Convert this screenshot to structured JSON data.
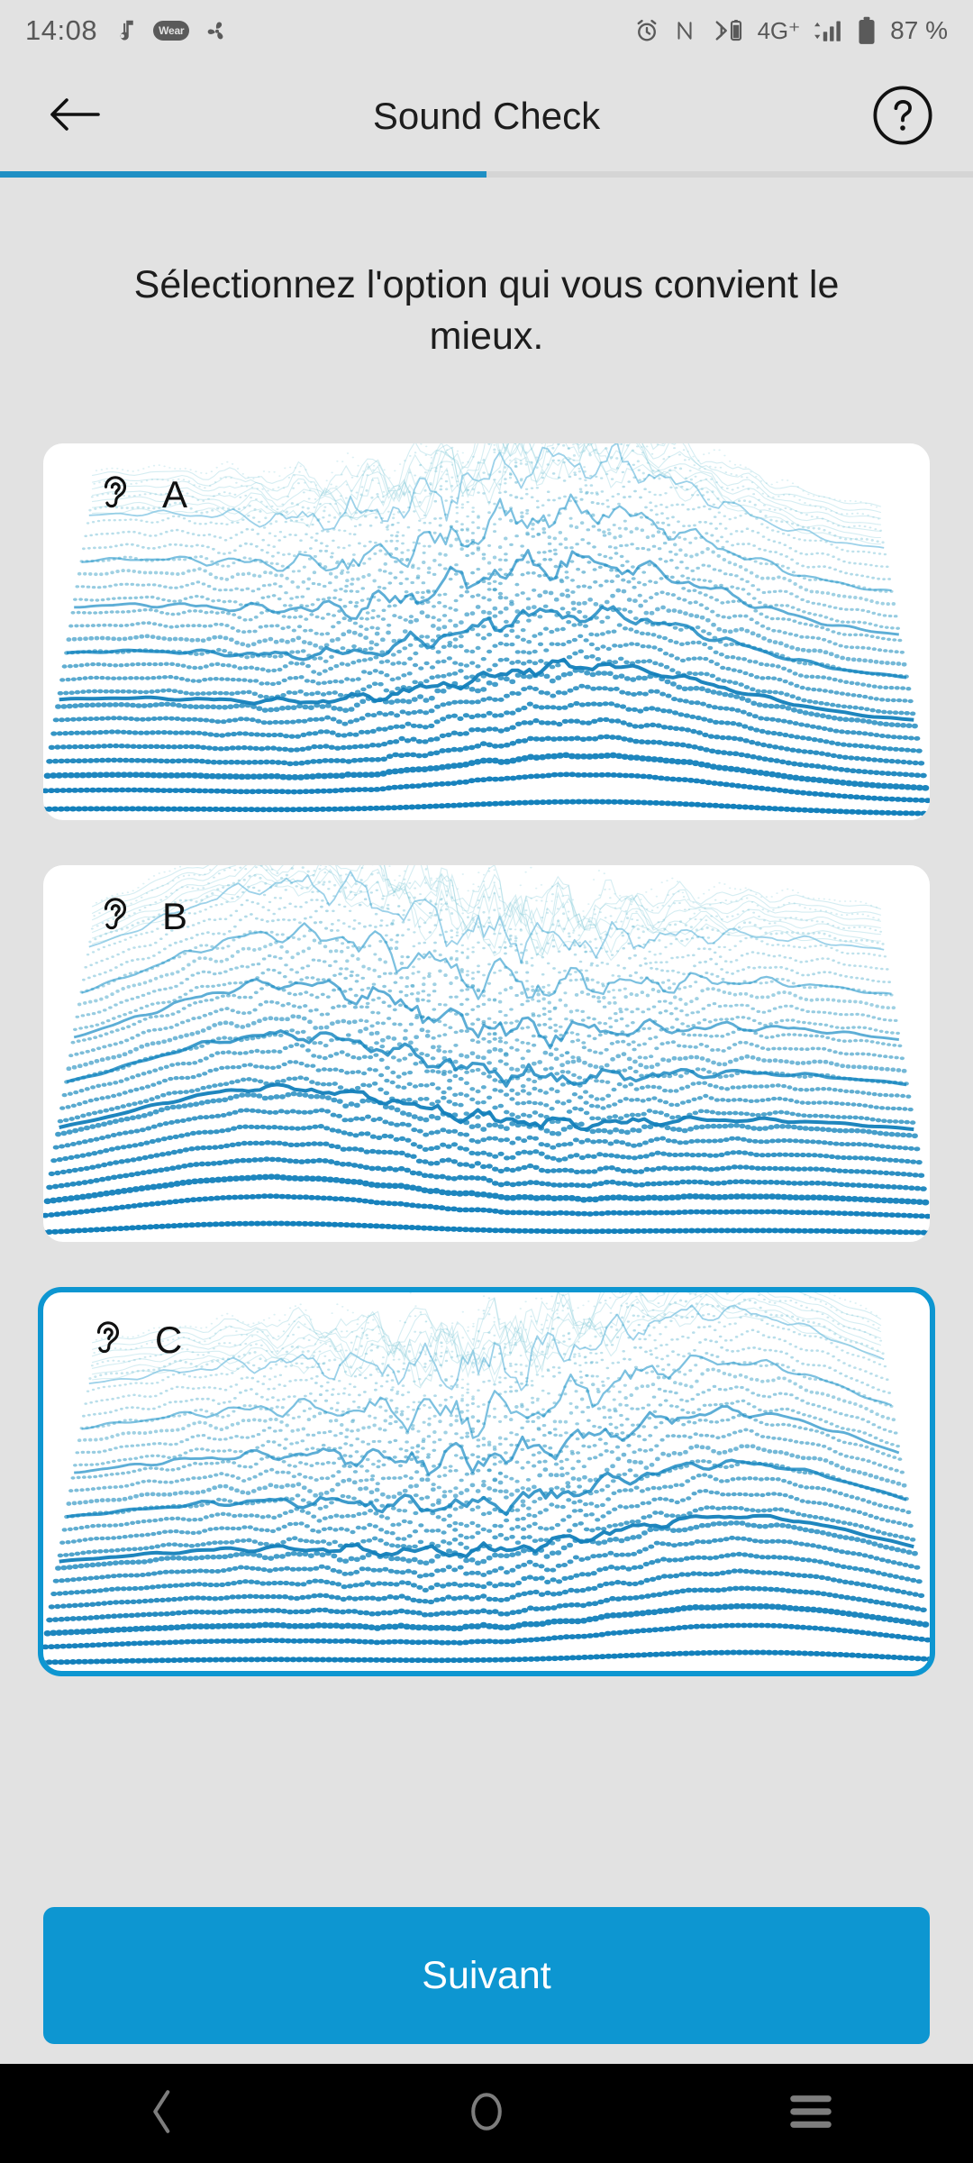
{
  "status_bar": {
    "time": "14:08",
    "left_icons": [
      {
        "name": "music-note-icon",
        "glyph": "♫"
      },
      {
        "name": "wear-badge-icon",
        "label": "Wear"
      },
      {
        "name": "fan-icon",
        "glyph": "❃"
      }
    ],
    "right_icons": [
      {
        "name": "alarm-icon"
      },
      {
        "name": "nfc-icon"
      },
      {
        "name": "bluetooth-battery-icon"
      },
      {
        "name": "network-type-icon",
        "label": "4G⁺"
      },
      {
        "name": "signal-bars-icon"
      },
      {
        "name": "battery-icon"
      }
    ],
    "battery_percent": "87 %"
  },
  "app_bar": {
    "back_label": "Retour",
    "title": "Sound Check",
    "help_label": "?",
    "progress_percent": 50
  },
  "main": {
    "heading": "Sélectionnez l'option qui vous convient le mieux.",
    "options": [
      {
        "letter": "A",
        "icon": "ear-icon",
        "selected": false,
        "peak_position": "center-right"
      },
      {
        "letter": "B",
        "icon": "ear-icon",
        "selected": false,
        "peak_position": "left"
      },
      {
        "letter": "C",
        "icon": "ear-icon",
        "selected": true,
        "peak_position": "right"
      }
    ]
  },
  "cta": {
    "label": "Suivant"
  },
  "nav_bar": {
    "back": "back-nav-icon",
    "home": "home-nav-icon",
    "recents": "recents-nav-icon"
  },
  "colors": {
    "accent": "#0d96d1",
    "progress": "#1f8fc4",
    "background": "#e2e2e2",
    "card": "#ffffff",
    "text": "#1d1d1d",
    "status_text": "#585858",
    "nav_bar": "#000000",
    "wave_dark": "#1380bb",
    "wave_mid": "#1a9ad0",
    "wave_light": "#7fc9d8"
  }
}
